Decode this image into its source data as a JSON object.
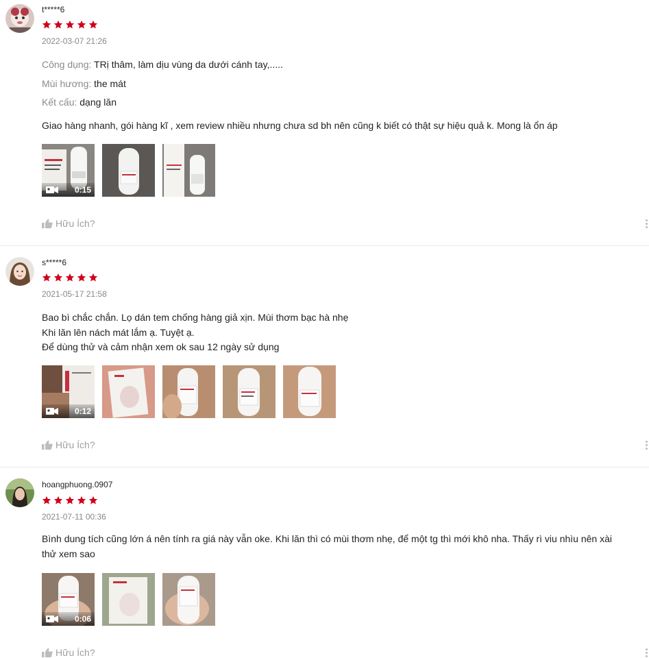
{
  "helpful_label": "Hữu Ích?",
  "star_color": "#d0011b",
  "reviews": [
    {
      "username": "t*****6",
      "rating": 5,
      "date": "2022-03-07 21:26",
      "attributes": [
        {
          "label": "Công dụng:",
          "value": "TRị thâm, làm dịu vùng da dưới cánh tay,....."
        },
        {
          "label": "Mùi hương:",
          "value": "the mát"
        },
        {
          "label": "Kết cấu:",
          "value": "dạng lăn"
        }
      ],
      "text_lines": [
        "Giao hàng nhanh, gói hàng kĩ , xem review nhiều nhưng chưa sd bh nên cũng k biết có thật sự hiệu quả k. Mong là ổn áp"
      ],
      "media": [
        {
          "type": "video",
          "duration": "0:15"
        },
        {
          "type": "image"
        },
        {
          "type": "image"
        }
      ]
    },
    {
      "username": "s*****6",
      "rating": 5,
      "date": "2021-05-17 21:58",
      "attributes": [],
      "text_lines": [
        "Bao bì chắc chắn. Lọ dán tem chống hàng giả xịn. Mùi thơm bạc hà nhẹ",
        "Khi lăn lên nách mát lắm ạ. Tuyệt ạ.",
        "Để dùng thử và cảm nhận xem ok sau 12 ngày sử dụng"
      ],
      "media": [
        {
          "type": "video",
          "duration": "0:12"
        },
        {
          "type": "image"
        },
        {
          "type": "image"
        },
        {
          "type": "image"
        },
        {
          "type": "image"
        }
      ]
    },
    {
      "username": "hoangphuong.0907",
      "rating": 5,
      "date": "2021-07-11 00:36",
      "attributes": [],
      "text_lines": [
        "Bình dung tích cũng lớn á nên tính ra giá này vẫn oke. Khi lăn thì có mùi thơm nhẹ, để một tg thì mới khô nha. Thấy rì viu nhìu nên xài",
        "thử xem sao"
      ],
      "media": [
        {
          "type": "video",
          "duration": "0:06"
        },
        {
          "type": "image"
        },
        {
          "type": "image"
        }
      ]
    }
  ]
}
